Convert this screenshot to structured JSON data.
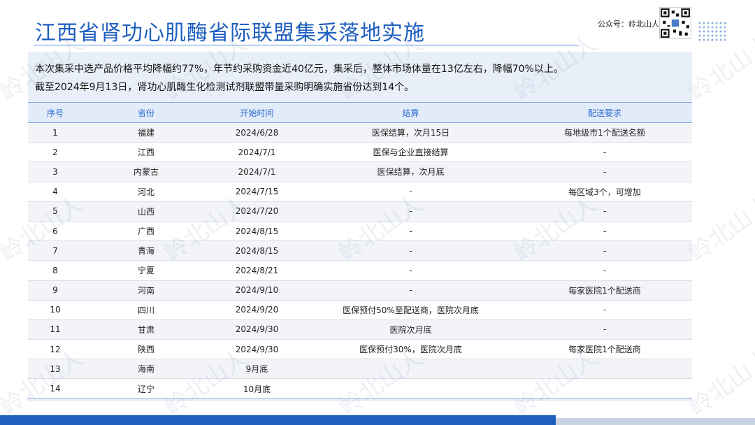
{
  "header": {
    "title": "江西省肾功心肌酶省际联盟集采落地实施",
    "account": "公众号：岭北山人"
  },
  "summary": {
    "line1": "本次集采中选产品价格平均降幅约77%，年节约采购资金近40亿元，集采后，整体市场体量在13亿左右，降幅70%以上。",
    "line2": "截至2024年9月13日，肾功心肌酶生化检测试剂联盟带量采购明确实施省份达到14个。"
  },
  "table": {
    "headers": [
      "序号",
      "省份",
      "开始时间",
      "结算",
      "配送要求"
    ],
    "rows": [
      [
        "1",
        "福建",
        "2024/6/28",
        "医保结算，次月15日",
        "每地级市1个配送名额"
      ],
      [
        "2",
        "江西",
        "2024/7/1",
        "医保与企业直接结算",
        "-"
      ],
      [
        "3",
        "内蒙古",
        "2024/7/1",
        "医保结算，次月底",
        "-"
      ],
      [
        "4",
        "河北",
        "2024/7/15",
        "-",
        "每区域3个，可增加"
      ],
      [
        "5",
        "山西",
        "2024/7/20",
        "-",
        "-"
      ],
      [
        "6",
        "广西",
        "2024/8/15",
        "-",
        "-"
      ],
      [
        "7",
        "青海",
        "2024/8/15",
        "-",
        "-"
      ],
      [
        "8",
        "宁夏",
        "2024/8/21",
        "-",
        "-"
      ],
      [
        "9",
        "河南",
        "2024/9/10",
        "-",
        "每家医院1个配送商"
      ],
      [
        "10",
        "四川",
        "2024/9/20",
        "医保预付50%至配送商，医院次月底",
        "-"
      ],
      [
        "11",
        "甘肃",
        "2024/9/30",
        "医院次月底",
        "-"
      ],
      [
        "12",
        "陕西",
        "2024/9/30",
        "医保预付30%，医院次月底",
        "每家医院1个配送商"
      ],
      [
        "13",
        "海南",
        "9月底",
        "",
        ""
      ],
      [
        "14",
        "辽宁",
        "10月底",
        "",
        ""
      ]
    ]
  },
  "watermark": "岭北山人",
  "colors": {
    "title": "#1f5fbf",
    "header_text": "#2c6bd1",
    "panel": "#e9eff9",
    "bar_dark": "#1f5fbf",
    "bar_light": "#c9d3e2"
  }
}
